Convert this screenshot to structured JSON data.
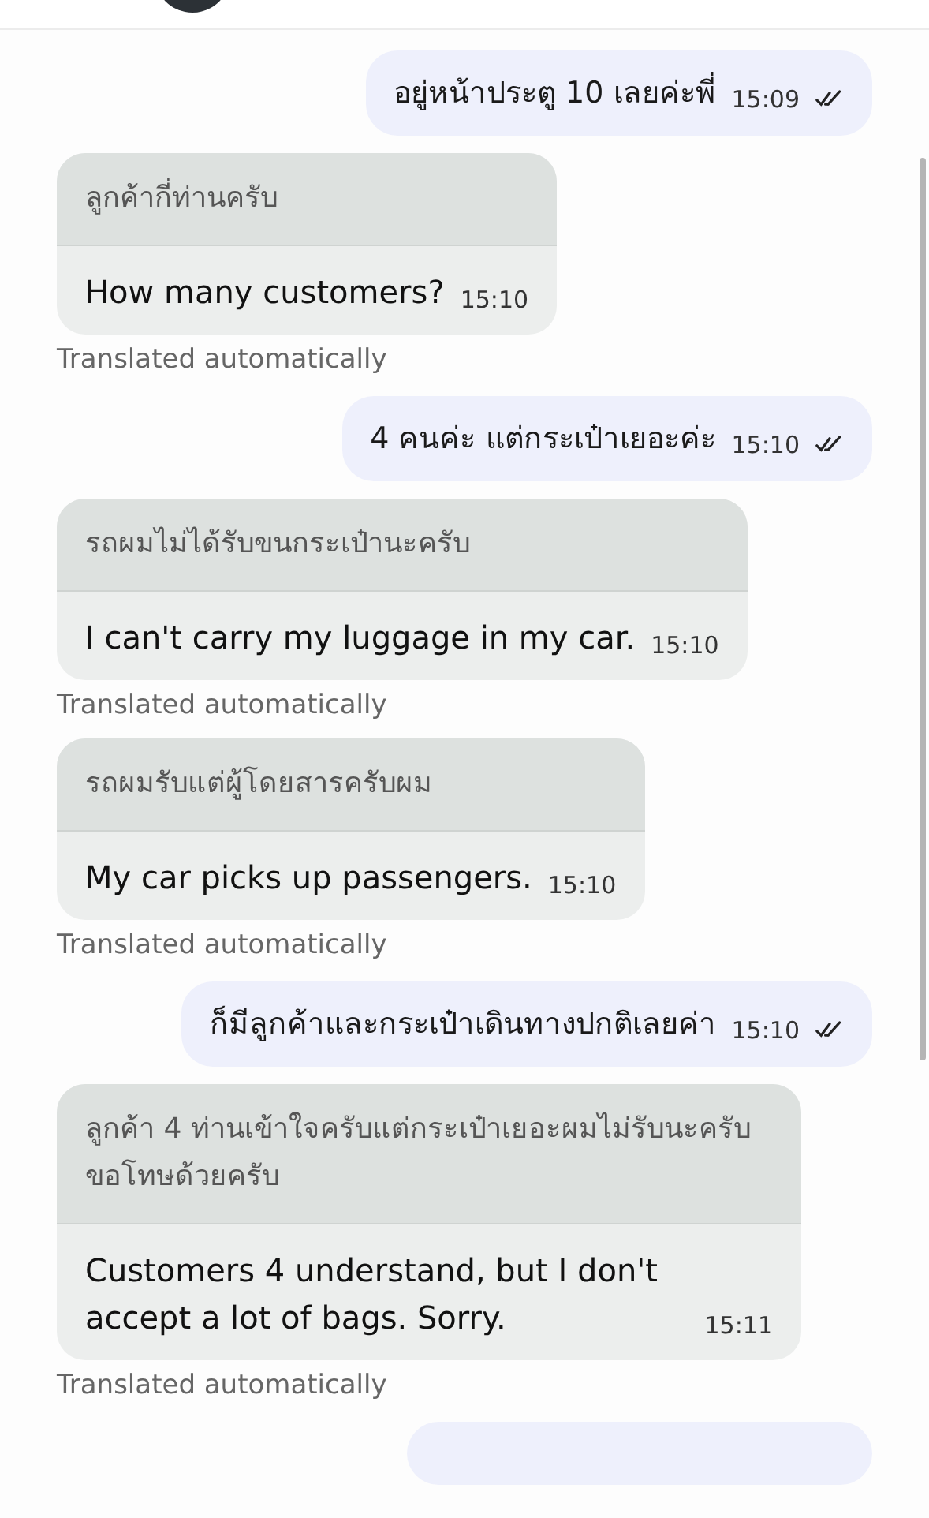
{
  "messages": [
    {
      "kind": "outgoing",
      "text": "อยู่หน้าประตู 10 เลยค่ะพี่",
      "time": "15:09",
      "read": true
    },
    {
      "kind": "incoming",
      "original": "ลูกค้ากี่ท่านครับ",
      "translation": "How many customers?",
      "time": "15:10",
      "note": "Translated automatically"
    },
    {
      "kind": "outgoing",
      "text": "4 คนค่ะ แต่กระเป๋าเยอะค่ะ",
      "time": "15:10",
      "read": true
    },
    {
      "kind": "incoming",
      "original": "รถผมไม่ได้รับขนกระเป๋านะครับ",
      "translation": "I can't carry my luggage in my car.",
      "time": "15:10",
      "note": "Translated automatically"
    },
    {
      "kind": "incoming",
      "original": "รถผมรับแต่ผู้โดยสารครับผม",
      "translation": "My car picks up passengers.",
      "time": "15:10",
      "note": "Translated automatically"
    },
    {
      "kind": "outgoing",
      "text": "ก็มีลูกค้าและกระเป๋าเดินทางปกติเลยค่า",
      "time": "15:10",
      "read": true
    },
    {
      "kind": "incoming",
      "original": "ลูกค้า 4 ท่านเข้าใจครับแต่กระเป๋าเยอะผมไม่รับนะครับขอโทษด้วยครับ",
      "translation": "Customers 4 understand, but I don't accept a lot of bags. Sorry.",
      "time": "15:11",
      "note": "Translated automatically"
    }
  ]
}
